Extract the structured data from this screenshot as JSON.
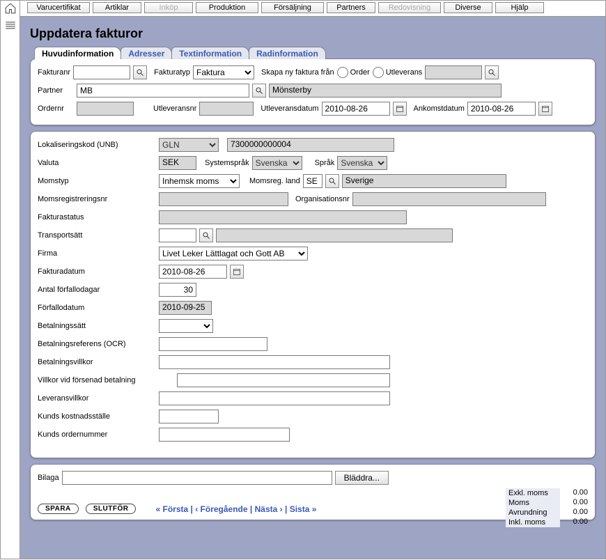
{
  "topmenu": {
    "varucertifikat": "Varucertifikat",
    "artiklar": "Artiklar",
    "inkop": "Inköp",
    "produktion": "Produktion",
    "forsaljning": "Försäljning",
    "partners": "Partners",
    "redovisning": "Redovisning",
    "diverse": "Diverse",
    "hjalp": "Hjälp"
  },
  "page": {
    "title": "Uppdatera fakturor"
  },
  "tabs": {
    "huvud": "Huvudinformation",
    "adresser": "Adresser",
    "textinfo": "Textinformation",
    "radinfo": "Radinformation"
  },
  "header": {
    "fakturanr_lbl": "Fakturanr",
    "fakturanr_val": "",
    "fakturatyp_lbl": "Fakturatyp",
    "fakturatyp_val": "Faktura",
    "skapa_lbl": "Skapa ny faktura från",
    "order_lbl": "Order",
    "utleverans_opt_lbl": "Utleverans",
    "utlev_search_val": "",
    "partner_lbl": "Partner",
    "partner_code": "MB",
    "partner_name": "Mönsterby",
    "ordernr_lbl": "Ordernr",
    "ordernr_val": "",
    "utleveransnr_lbl": "Utleveransnr",
    "utleveransnr_val": "",
    "utleveransdatum_lbl": "Utleveransdatum",
    "utleveransdatum_val": "2010-08-26",
    "ankomstdatum_lbl": "Ankomstdatum",
    "ankomstdatum_val": "2010-08-26"
  },
  "body": {
    "lokkod_lbl": "Lokaliseringskod (UNB)",
    "lokkod_type": "GLN",
    "lokkod_val": "7300000000004",
    "valuta_lbl": "Valuta",
    "valuta_val": "SEK",
    "systemsprak_lbl": "Systemspråk",
    "systemsprak_val": "Svenska",
    "sprak_lbl": "Språk",
    "sprak_val": "Svenska",
    "momstyp_lbl": "Momstyp",
    "momstyp_val": "Inhemsk moms",
    "momsreg_land_lbl": "Momsreg. land",
    "momsreg_land_code": "SE",
    "momsreg_land_name": "Sverige",
    "momsregnr_lbl": "Momsregistreringsnr",
    "momsregnr_val": "",
    "orgnr_lbl": "Organisationsnr",
    "orgnr_val": "",
    "fakturastatus_lbl": "Fakturastatus",
    "fakturastatus_val": "",
    "transport_lbl": "Transportsätt",
    "transport_code": "",
    "transport_name": "",
    "firma_lbl": "Firma",
    "firma_val": "Livet Leker Lättlagat och Gott AB",
    "fakturadatum_lbl": "Fakturadatum",
    "fakturadatum_val": "2010-08-26",
    "forfallodagar_lbl": "Antal förfallodagar",
    "forfallodagar_val": "30",
    "forfallodatum_lbl": "Förfallodatum",
    "forfallodatum_val": "2010-09-25",
    "betalningssatt_lbl": "Betalningssätt",
    "betalningssatt_val": "",
    "ocr_lbl": "Betalningsreferens (OCR)",
    "ocr_val": "",
    "betvillkor_lbl": "Betalningsvillkor",
    "betvillkor_val": "",
    "forsenad_lbl": "Villkor vid försenad betalning",
    "forsenad_val": "",
    "leveransvillkor_lbl": "Leveransvillkor",
    "leveransvillkor_val": "",
    "kostnadsstalle_lbl": "Kunds kostnadsställe",
    "kostnadsstalle_val": "",
    "kundorder_lbl": "Kunds ordernummer",
    "kundorder_val": ""
  },
  "footer": {
    "bilaga_lbl": "Bilaga",
    "bilaga_val": "",
    "browse_lbl": "Bläddra...",
    "spara": "SPARA",
    "slutfor": "SLUTFÖR",
    "nav_first": "« Första",
    "nav_prev": "‹ Föregående",
    "nav_next": "Nästa ›",
    "nav_last": "Sista »",
    "tot_exkl_lbl": "Exkl. moms",
    "tot_exkl_val": "0.00",
    "tot_moms_lbl": "Moms",
    "tot_moms_val": "0.00",
    "tot_avr_lbl": "Avrundning",
    "tot_avr_val": "0.00",
    "tot_inkl_lbl": "Inkl. moms",
    "tot_inkl_val": "0.00"
  }
}
